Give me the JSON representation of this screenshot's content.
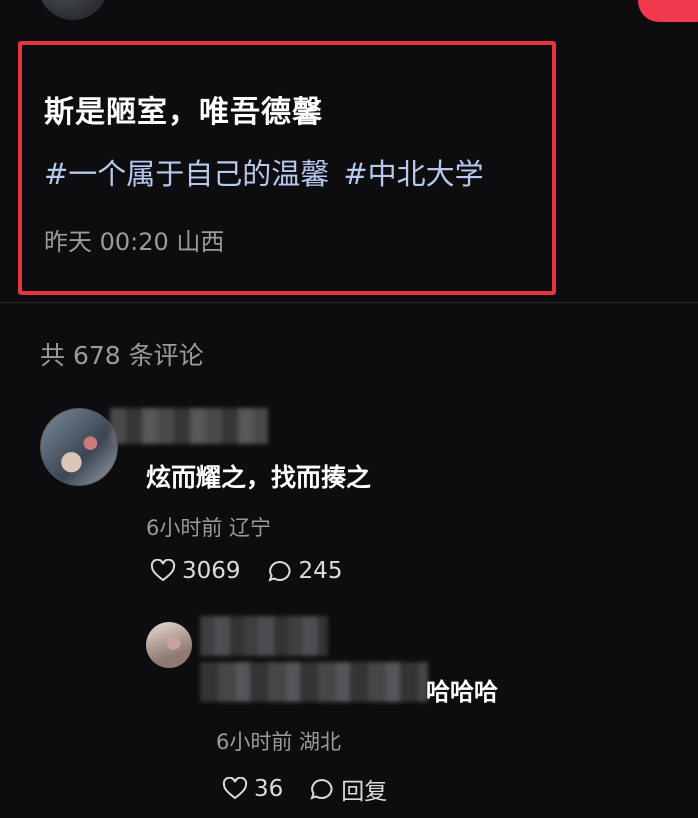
{
  "post": {
    "title": "斯是陋室，唯吾德馨",
    "tags": [
      "#一个属于自己的温馨",
      "#中北大学"
    ],
    "meta": "昨天 00:20 山西"
  },
  "comments_header": {
    "count_text": "共 678 条评论"
  },
  "comment1": {
    "text": "炫而耀之，找而揍之",
    "meta": "6小时前 辽宁",
    "likes": "3069",
    "replies": "245"
  },
  "reply1": {
    "text": "哈哈哈",
    "meta": "6小时前 湖北",
    "likes": "36",
    "reply_label": "回复"
  },
  "icons": {
    "like": "heart-outline-icon",
    "comment": "speech-bubble-icon"
  },
  "colors": {
    "highlight_border": "#e5343c",
    "tag_color": "#b7c8ef",
    "background": "#0d0d0f",
    "muted_text": "#9a9a9f"
  }
}
